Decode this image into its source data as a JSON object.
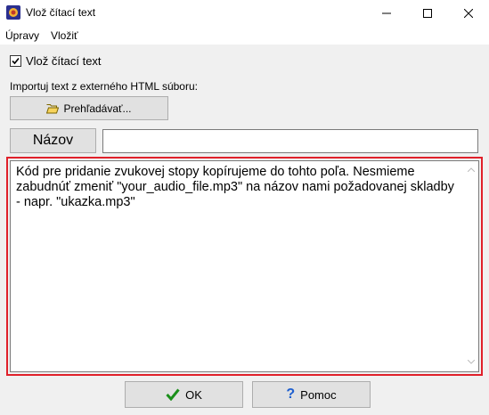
{
  "window": {
    "title": "Vlož čítací text",
    "icon": "app-icon"
  },
  "menu": {
    "items": [
      "Úpravy",
      "Vložiť"
    ]
  },
  "checkbox": {
    "label": "Vlož čítací text",
    "checked": true,
    "mark": "✓"
  },
  "import": {
    "label": "Importuj text z externého HTML súboru:",
    "browse_button": "Prehľadávať...",
    "browse_icon": "folder-open-icon"
  },
  "title_field": {
    "label": "Názov",
    "value": ""
  },
  "content": {
    "text": "Kód pre pridanie zvukovej stopy kopírujeme do tohto poľa. Nesmieme zabudnúť zmeniť \"your_audio_file.mp3\" na názov nami požadovanej skladby - napr. \"ukazka.mp3\"",
    "highlight_color": "#e0202a"
  },
  "buttons": {
    "ok": "OK",
    "ok_icon": "checkmark-icon",
    "help": "Pomoc",
    "help_icon": "question-mark-icon"
  }
}
